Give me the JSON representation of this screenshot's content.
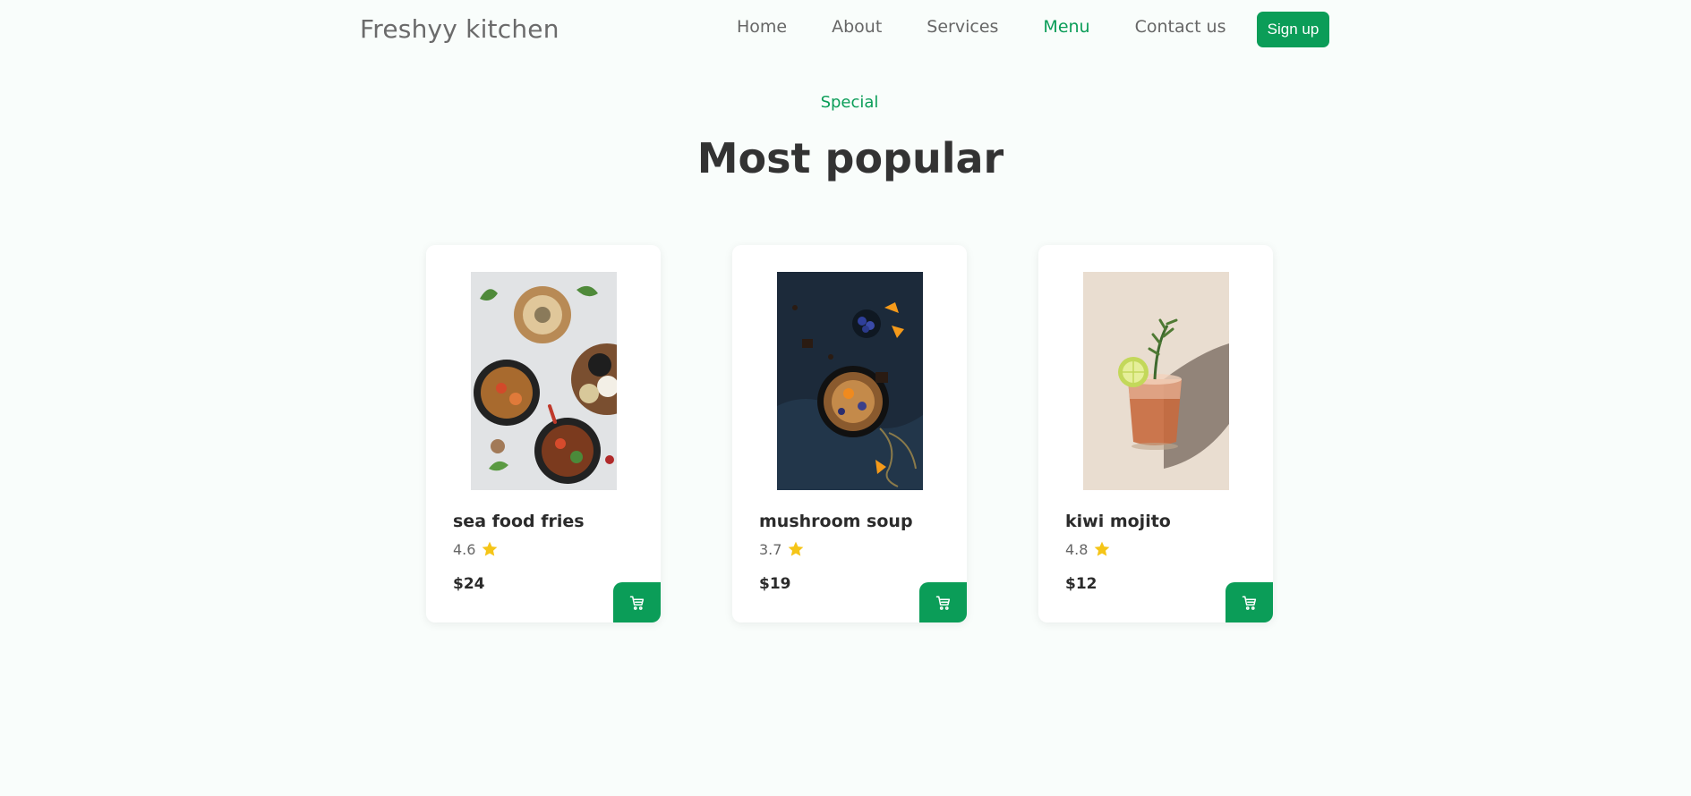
{
  "nav": {
    "brand": "Freshyy kitchen",
    "links": [
      "Home",
      "About",
      "Services",
      "Menu",
      "Contact us"
    ],
    "active": "Menu",
    "signup_label": "Sign up"
  },
  "section": {
    "tag": "Special",
    "title": "Most popular"
  },
  "cards": [
    {
      "name": "sea food fries",
      "rating": "4.6",
      "price": "$24",
      "image": "seafood-platter-photo"
    },
    {
      "name": "mushroom soup",
      "rating": "3.7",
      "price": "$19",
      "image": "porridge-bowl-photo"
    },
    {
      "name": "kiwi mojito",
      "rating": "4.8",
      "price": "$12",
      "image": "cocktail-glass-photo"
    }
  ],
  "colors": {
    "accent": "#0b9d58",
    "star": "#f5c518",
    "background": "#f9fdfb"
  },
  "icons": {
    "rating": "star-icon",
    "cart": "cart-icon"
  }
}
